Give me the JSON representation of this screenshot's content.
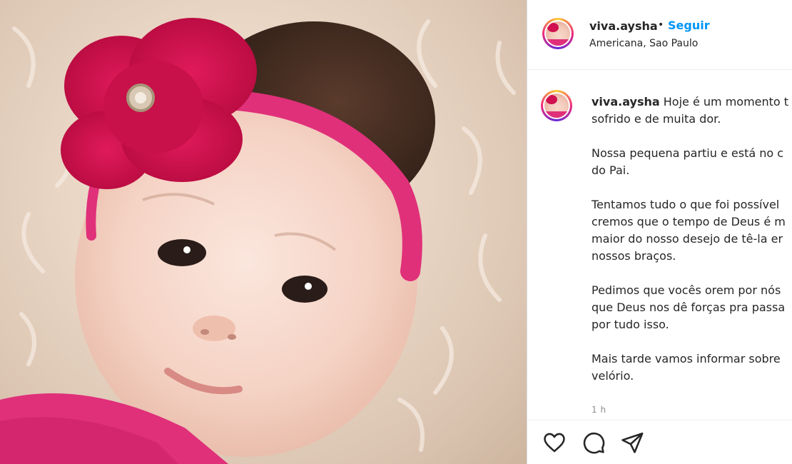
{
  "post": {
    "username": "viva.aysha",
    "dot": "•",
    "follow_label": "Seguir",
    "location": "Americana, Sao Paulo",
    "caption": {
      "username": "viva.aysha",
      "lines": [
        "Hoje é um momento t",
        "sofrido e de muita dor.",
        "Nossa pequena partiu e está no c",
        "do Pai.",
        "Tentamos tudo o que foi possível",
        "cremos que o tempo de Deus é m",
        "maior do nosso desejo de tê-la er",
        "nossos braços.",
        "Pedimos que vocês orem por nós",
        "que Deus nos dê forças pra passa",
        "por tudo isso.",
        "Mais tarde vamos informar sobre",
        "velório."
      ]
    },
    "time": "1 h",
    "icons": {
      "like": "heart-icon",
      "comment": "comment-icon",
      "share": "send-icon"
    },
    "colors": {
      "follow": "#0095f6",
      "headband": "#e0307a",
      "flower": "#d0104f"
    }
  }
}
